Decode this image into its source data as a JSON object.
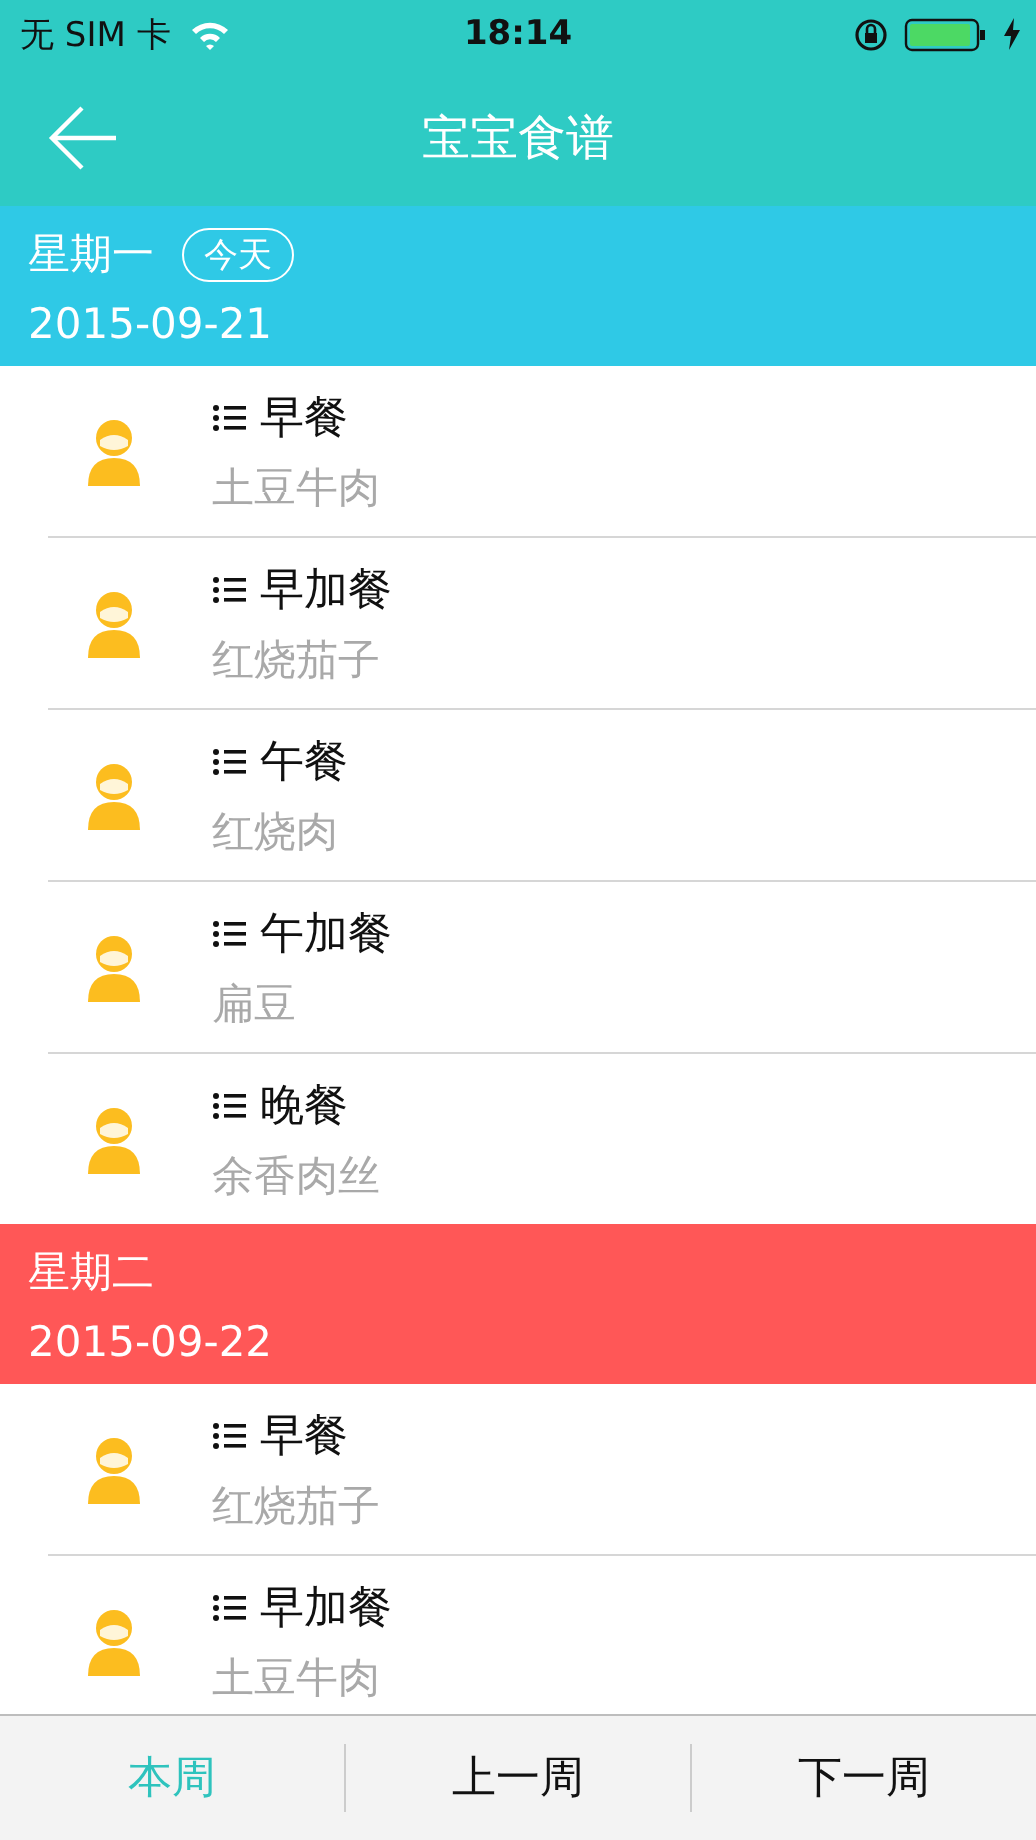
{
  "status_bar": {
    "carrier": "无 SIM 卡",
    "time": "18:14"
  },
  "header": {
    "title": "宝宝食谱"
  },
  "days": [
    {
      "weekday": "星期一",
      "badge": "今天",
      "date": "2015-09-21",
      "color": "#2fc9e6",
      "meals": [
        {
          "meal": "早餐",
          "dish": "土豆牛肉"
        },
        {
          "meal": "早加餐",
          "dish": "红烧茄子"
        },
        {
          "meal": "午餐",
          "dish": "红烧肉"
        },
        {
          "meal": "午加餐",
          "dish": "扁豆"
        },
        {
          "meal": "晚餐",
          "dish": "余香肉丝"
        }
      ]
    },
    {
      "weekday": "星期二",
      "date": "2015-09-22",
      "color": "#ff5757",
      "meals": [
        {
          "meal": "早餐",
          "dish": "红烧茄子"
        },
        {
          "meal": "早加餐",
          "dish": "土豆牛肉"
        }
      ]
    }
  ],
  "tabs": [
    {
      "label": "本周",
      "selected": true
    },
    {
      "label": "上一周",
      "selected": false
    },
    {
      "label": "下一周",
      "selected": false
    }
  ]
}
